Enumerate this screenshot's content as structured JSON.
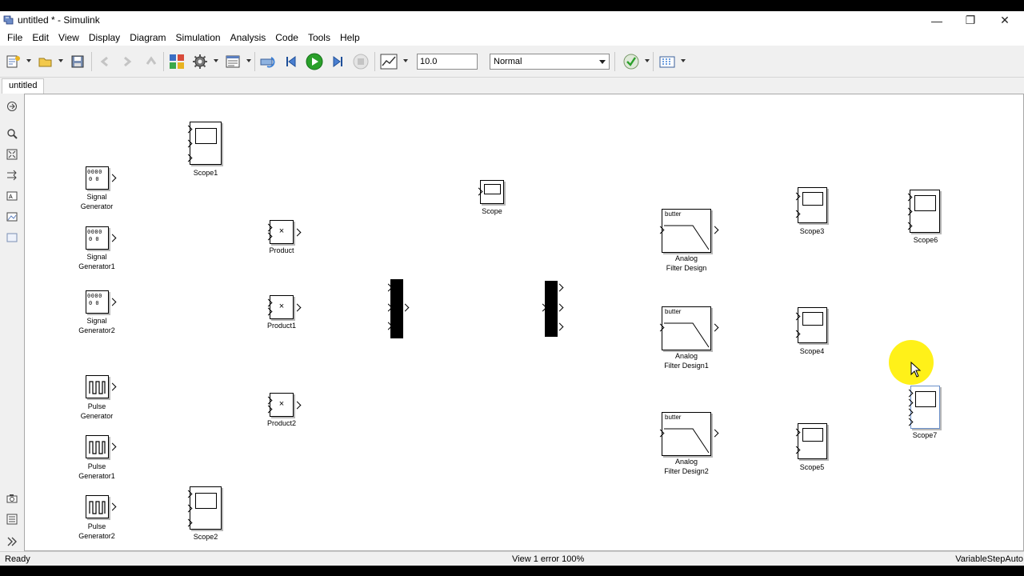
{
  "window": {
    "title": "untitled * - Simulink",
    "minimize_glyph": "—",
    "restore_glyph": "❐",
    "close_glyph": "✕"
  },
  "menu": [
    "File",
    "Edit",
    "View",
    "Display",
    "Diagram",
    "Simulation",
    "Analysis",
    "Code",
    "Tools",
    "Help"
  ],
  "toolbar": {
    "stop_time": "10.0",
    "sim_mode": "Normal",
    "icons": [
      "new-model-icon",
      "open-icon",
      "save-icon",
      "back-icon",
      "forward-icon",
      "up-icon",
      "library-browser-icon",
      "model-config-icon",
      "model-explorer-icon",
      "step-back-icon",
      "run-icon",
      "step-forward-icon",
      "stop-icon",
      "record-icon",
      "model-advisor-icon",
      "build-icon"
    ]
  },
  "tab": {
    "label": "untitled"
  },
  "blocks": {
    "sg0": [
      "Signal",
      "Generator"
    ],
    "sg1": [
      "Signal",
      "Generator1"
    ],
    "sg2": [
      "Signal",
      "Generator2"
    ],
    "pg0": [
      "Pulse",
      "Generator"
    ],
    "pg1": [
      "Pulse",
      "Generator1"
    ],
    "pg2": [
      "Pulse",
      "Generator2"
    ],
    "scope1": "Scope1",
    "scope2": "Scope2",
    "scope": "Scope",
    "product": "Product",
    "product1": "Product1",
    "product2": "Product2",
    "product_symbol": "×",
    "sg_glyph": "0000",
    "sg_glyph2": "0 0",
    "filter_tag": "butter",
    "afd0": [
      "Analog",
      "Filter Design"
    ],
    "afd1": [
      "Analog",
      "Filter Design1"
    ],
    "afd2": [
      "Analog",
      "Filter Design2"
    ],
    "scope3": "Scope3",
    "scope4": "Scope4",
    "scope5": "Scope5",
    "scope6": "Scope6",
    "scope7": "Scope7"
  },
  "status": {
    "left": "Ready",
    "center": "View 1 error  100%",
    "right": "VariableStepAuto"
  },
  "colors": {
    "run": "#2aa02a",
    "highlight": "#ffef00",
    "canvas": "#ffffff",
    "chrome": "#f0f0f0"
  }
}
